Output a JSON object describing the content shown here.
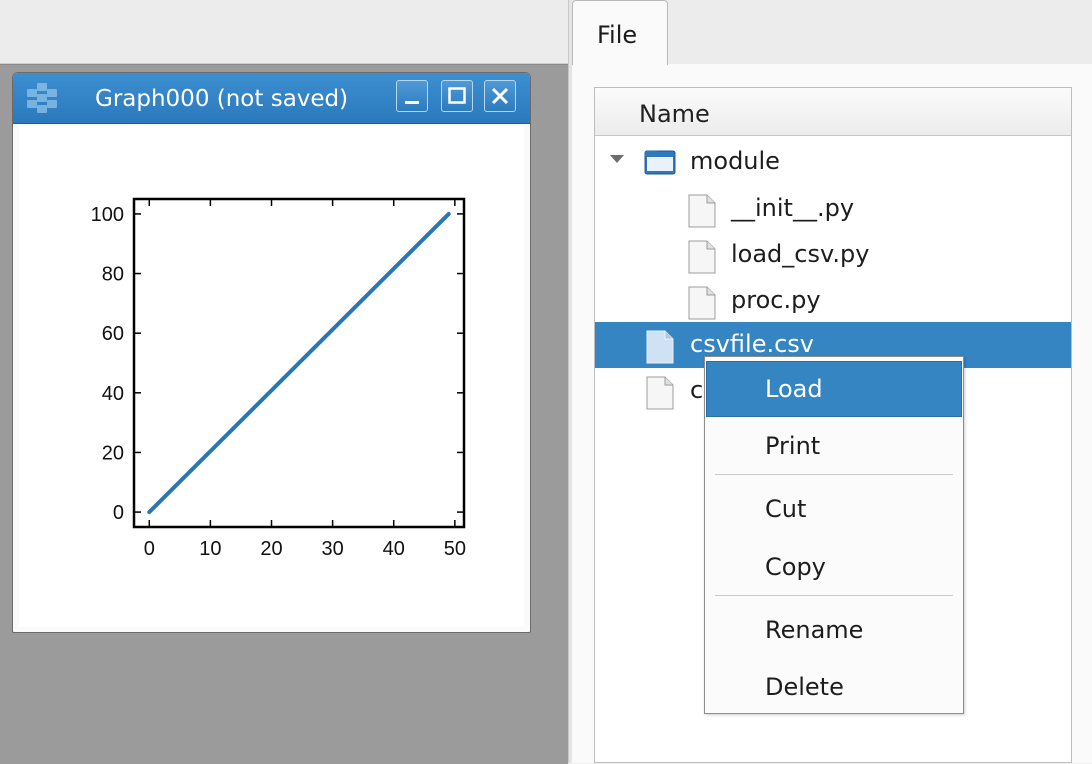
{
  "graph_window": {
    "title": "Graph000 (not saved)",
    "buttons": [
      "minimize",
      "maximize",
      "close"
    ]
  },
  "chart_data": {
    "type": "line",
    "x": [
      0,
      49
    ],
    "series": [
      {
        "values": [
          0,
          100
        ]
      }
    ],
    "xlim": [
      -2.5,
      51.5
    ],
    "ylim": [
      -5,
      105
    ],
    "xticks": [
      0,
      10,
      20,
      30,
      40,
      50
    ],
    "yticks": [
      0,
      20,
      40,
      60,
      80,
      100
    ],
    "xtick_labels": [
      "0",
      "10",
      "20",
      "30",
      "40",
      "50"
    ],
    "ytick_labels": [
      "0",
      "20",
      "40",
      "60",
      "80",
      "100"
    ],
    "line_color": "#2a76b2",
    "grid": false
  },
  "tabs": [
    {
      "label": "File",
      "active": true
    }
  ],
  "file_tree": {
    "header": "Name",
    "items": [
      {
        "label": "module",
        "icon": "folder-icon",
        "expanded": true
      },
      {
        "label": "__init__.py",
        "icon": "file-icon"
      },
      {
        "label": "load_csv.py",
        "icon": "file-icon"
      },
      {
        "label": "proc.py",
        "icon": "file-icon"
      },
      {
        "label": "csvfile.csv",
        "icon": "file-icon",
        "selected": true
      },
      {
        "label": "c",
        "icon": "file-icon"
      }
    ]
  },
  "context_menu": {
    "items": [
      {
        "label": "Load",
        "active": true
      },
      {
        "label": "Print"
      },
      {
        "label": "Cut"
      },
      {
        "label": "Copy"
      },
      {
        "label": "Rename"
      },
      {
        "label": "Delete"
      }
    ]
  },
  "colors": {
    "accent": "#3585c2",
    "titlebar": "#2a79bd",
    "mdi_background": "#9b9b9b"
  }
}
